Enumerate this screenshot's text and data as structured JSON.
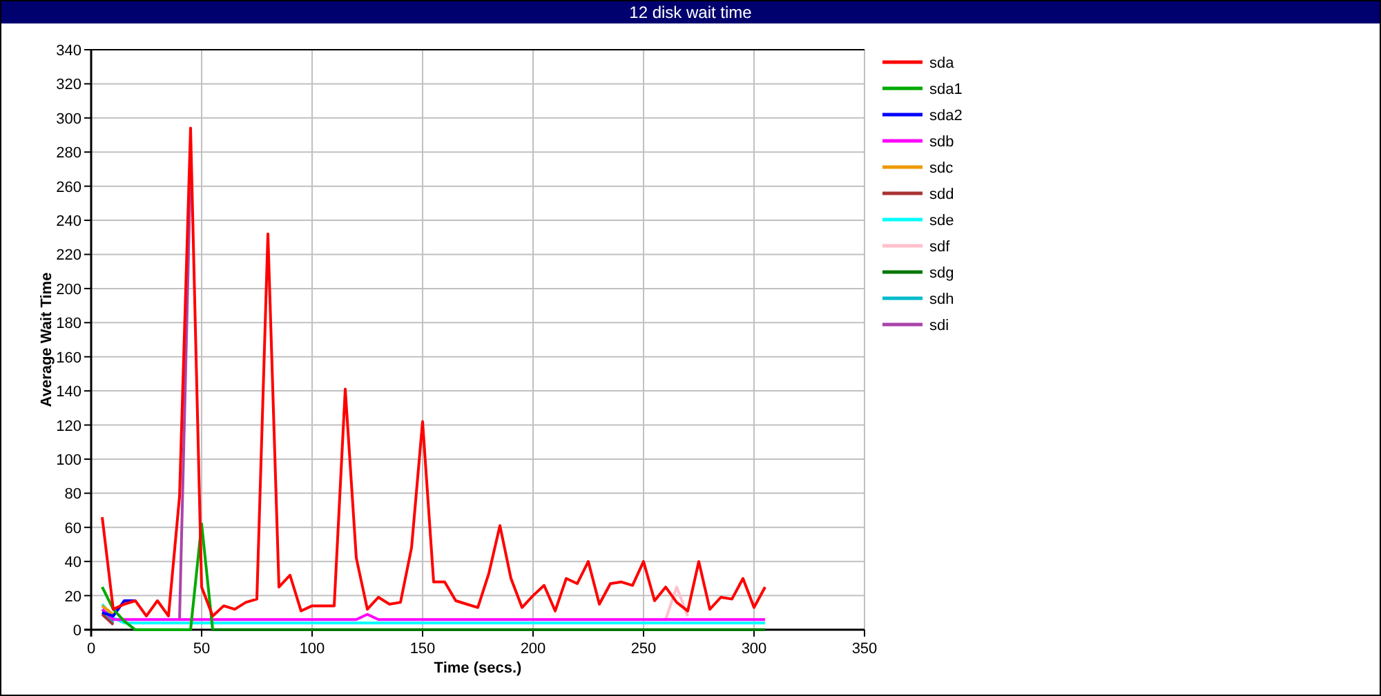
{
  "chart_data": {
    "type": "line",
    "title": "12 disk wait time",
    "xlabel": "Time (secs.)",
    "ylabel": "Average Wait Time",
    "x": [
      5,
      10,
      15,
      20,
      25,
      30,
      35,
      40,
      45,
      50,
      55,
      60,
      65,
      70,
      75,
      80,
      85,
      90,
      95,
      100,
      105,
      110,
      115,
      120,
      125,
      130,
      135,
      140,
      145,
      150,
      155,
      160,
      165,
      170,
      175,
      180,
      185,
      190,
      195,
      200,
      205,
      210,
      215,
      220,
      225,
      230,
      235,
      240,
      245,
      250,
      255,
      260,
      265,
      270,
      275,
      280,
      285,
      290,
      295,
      300,
      305
    ],
    "grid": true,
    "legend": "right",
    "xlim": [
      0,
      350
    ],
    "ylim": [
      0,
      340
    ],
    "xticks": [
      0,
      50,
      100,
      150,
      200,
      250,
      300,
      350
    ],
    "yticks": [
      0,
      20,
      40,
      60,
      80,
      100,
      120,
      140,
      160,
      180,
      200,
      220,
      240,
      260,
      280,
      300,
      320,
      340
    ],
    "series": [
      {
        "name": "sda",
        "color": "#ff0000",
        "values": [
          66,
          12,
          15,
          17,
          8,
          17,
          8,
          78,
          294,
          25,
          8,
          14,
          12,
          16,
          18,
          232,
          25,
          32,
          11,
          14,
          14,
          14,
          141,
          42,
          12,
          19,
          15,
          16,
          48,
          122,
          28,
          28,
          17,
          15,
          13,
          33,
          61,
          30,
          13,
          20,
          26,
          11,
          30,
          27,
          40,
          15,
          27,
          28,
          26,
          40,
          17,
          25,
          16,
          11,
          40,
          12,
          19,
          18,
          30,
          13,
          25
        ]
      },
      {
        "name": "sda1",
        "color": "#00aa00",
        "values": [
          25,
          12,
          5,
          0,
          0,
          0,
          0,
          0,
          0,
          62,
          0,
          null,
          null,
          null,
          null,
          null,
          null,
          null,
          null,
          null,
          null,
          null,
          null,
          null,
          null,
          null,
          null,
          null,
          null,
          null,
          null,
          null,
          null,
          null,
          null,
          null,
          null,
          null,
          null,
          null,
          null,
          null,
          null,
          null,
          null,
          null,
          null,
          null,
          null,
          null,
          null,
          null,
          null,
          null,
          null,
          null,
          null,
          null,
          null,
          null,
          null
        ]
      },
      {
        "name": "sda2",
        "color": "#0000ff",
        "values": [
          10,
          8,
          17,
          17,
          null,
          null,
          null,
          null,
          null,
          null,
          null,
          null,
          null,
          null,
          null,
          null,
          null,
          null,
          null,
          null,
          null,
          null,
          null,
          null,
          null,
          null,
          null,
          null,
          null,
          null,
          null,
          null,
          null,
          null,
          null,
          null,
          null,
          null,
          null,
          null,
          null,
          null,
          null,
          null,
          null,
          null,
          null,
          null,
          null,
          null,
          null,
          null,
          null,
          null,
          null,
          null,
          null,
          null,
          null,
          null,
          null
        ]
      },
      {
        "name": "sdb",
        "color": "#ff00ff",
        "values": [
          12,
          6,
          6,
          6,
          6,
          6,
          6,
          6,
          6,
          6,
          6,
          6,
          6,
          6,
          6,
          6,
          6,
          6,
          6,
          6,
          6,
          6,
          6,
          6,
          9,
          6,
          6,
          6,
          6,
          6,
          6,
          6,
          6,
          6,
          6,
          6,
          6,
          6,
          6,
          6,
          6,
          6,
          6,
          6,
          6,
          6,
          6,
          6,
          6,
          6,
          6,
          6,
          6,
          6,
          6,
          6,
          6,
          6,
          6,
          6,
          6
        ]
      },
      {
        "name": "sdc",
        "color": "#ee9900",
        "values": [
          14,
          9,
          null,
          null,
          null,
          null,
          null,
          null,
          null,
          null,
          null,
          null,
          null,
          null,
          null,
          null,
          null,
          null,
          null,
          null,
          null,
          null,
          null,
          null,
          null,
          null,
          null,
          null,
          null,
          null,
          null,
          null,
          null,
          null,
          null,
          null,
          null,
          null,
          null,
          null,
          null,
          null,
          null,
          null,
          null,
          null,
          null,
          null,
          null,
          null,
          null,
          null,
          null,
          null,
          null,
          null,
          null,
          null,
          null,
          null,
          null
        ]
      },
      {
        "name": "sdd",
        "color": "#aa3333",
        "values": [
          9,
          3,
          null,
          null,
          null,
          null,
          null,
          null,
          null,
          null,
          null,
          null,
          null,
          null,
          null,
          null,
          null,
          null,
          null,
          null,
          null,
          null,
          null,
          null,
          null,
          null,
          null,
          null,
          null,
          null,
          null,
          null,
          null,
          null,
          null,
          null,
          null,
          null,
          null,
          null,
          null,
          null,
          null,
          null,
          null,
          null,
          null,
          null,
          null,
          null,
          null,
          null,
          null,
          null,
          null,
          null,
          null,
          null,
          null,
          null,
          null
        ]
      },
      {
        "name": "sde",
        "color": "#00ffff",
        "values": [
          15,
          7,
          4,
          4,
          4,
          4,
          4,
          4,
          4,
          4,
          4,
          4,
          4,
          4,
          4,
          4,
          4,
          4,
          4,
          4,
          4,
          4,
          4,
          4,
          4,
          4,
          4,
          4,
          4,
          4,
          4,
          4,
          4,
          4,
          4,
          4,
          4,
          4,
          4,
          4,
          4,
          4,
          4,
          4,
          4,
          4,
          4,
          4,
          4,
          4,
          4,
          4,
          4,
          4,
          4,
          4,
          4,
          4,
          4,
          4,
          4
        ]
      },
      {
        "name": "sdf",
        "color": "#ffc0cb",
        "values": [
          null,
          null,
          null,
          null,
          null,
          null,
          null,
          null,
          null,
          null,
          null,
          null,
          null,
          null,
          null,
          null,
          null,
          null,
          null,
          null,
          null,
          null,
          null,
          null,
          null,
          null,
          null,
          null,
          null,
          null,
          null,
          null,
          null,
          null,
          null,
          null,
          null,
          null,
          null,
          null,
          null,
          null,
          null,
          null,
          null,
          null,
          null,
          null,
          null,
          null,
          null,
          6,
          25,
          8,
          null,
          null,
          null,
          null,
          null,
          null,
          null
        ]
      },
      {
        "name": "sdg",
        "color": "#007700",
        "values": [
          null,
          null,
          null,
          null,
          null,
          null,
          null,
          null,
          null,
          null,
          0,
          0,
          0,
          0,
          0,
          0,
          0,
          0,
          0,
          0,
          0,
          0,
          0,
          0,
          0,
          0,
          0,
          0,
          0,
          0,
          0,
          0,
          0,
          0,
          0,
          0,
          0,
          0,
          0,
          0,
          0,
          0,
          0,
          0,
          0,
          0,
          0,
          0,
          0,
          0,
          0,
          0,
          0,
          0,
          0,
          0,
          0,
          0,
          0,
          0,
          0
        ]
      },
      {
        "name": "sdh",
        "color": "#00bbcc",
        "values": [
          12,
          4,
          null,
          null,
          null,
          null,
          null,
          null,
          null,
          null,
          null,
          null,
          null,
          null,
          null,
          null,
          null,
          null,
          null,
          null,
          null,
          null,
          null,
          null,
          null,
          null,
          null,
          null,
          null,
          null,
          null,
          null,
          null,
          null,
          null,
          null,
          null,
          null,
          null,
          null,
          null,
          null,
          null,
          null,
          null,
          null,
          null,
          null,
          null,
          null,
          null,
          null,
          null,
          null,
          null,
          null,
          null,
          null,
          null,
          null,
          null
        ]
      },
      {
        "name": "sdi",
        "color": "#aa44aa",
        "values": [
          10,
          5,
          null,
          null,
          null,
          null,
          null,
          6,
          270,
          null,
          null,
          null,
          null,
          null,
          null,
          null,
          null,
          null,
          null,
          null,
          null,
          null,
          null,
          null,
          null,
          null,
          null,
          null,
          null,
          null,
          null,
          null,
          null,
          null,
          null,
          null,
          null,
          null,
          null,
          null,
          null,
          null,
          null,
          null,
          null,
          null,
          null,
          null,
          null,
          null,
          null,
          null,
          null,
          null,
          null,
          null,
          null,
          null,
          null,
          null,
          null
        ]
      }
    ]
  }
}
